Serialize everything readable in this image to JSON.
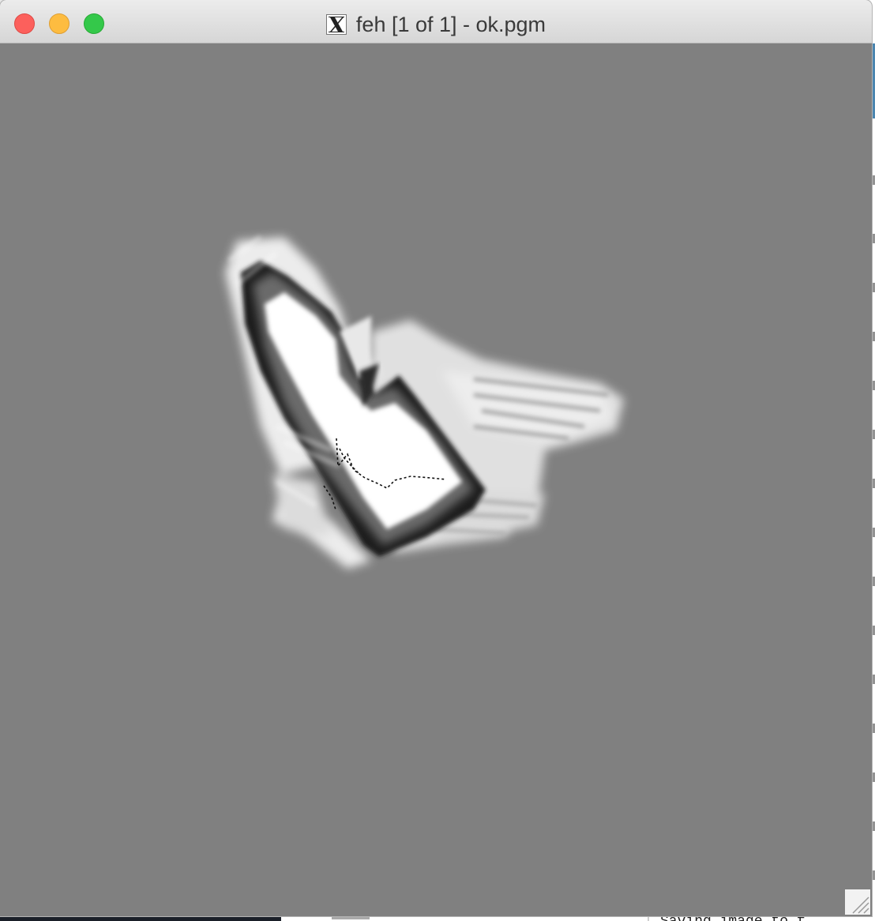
{
  "window": {
    "title": "feh [1 of 1] - ok.pgm",
    "app_icon": "x11-icon",
    "controls": [
      "close-icon",
      "minimize-icon",
      "maximize-icon"
    ],
    "colors": {
      "canvas_background": "#808080",
      "titlebar": "#e2e2e2"
    }
  },
  "image_view": {
    "file_name": "ok.pgm",
    "index": "1 of 1",
    "content": "grayscale occupancy map"
  },
  "background_terminal": {
    "visible_text": "Saving image to f"
  }
}
